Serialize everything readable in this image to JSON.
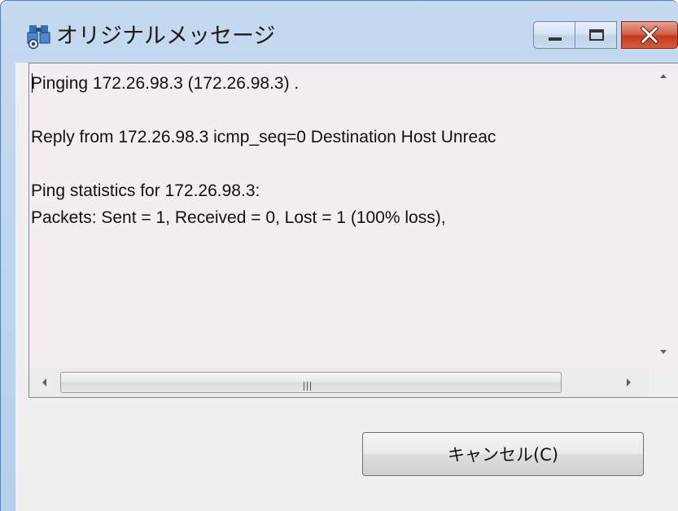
{
  "window": {
    "title": "オリジナルメッセージ",
    "icon": "binoculars-icon"
  },
  "title_bar_buttons": {
    "minimize": "minimize-icon",
    "maximize": "maximize-icon",
    "close": "close-icon"
  },
  "message": {
    "lines": [
      "Pinging 172.26.98.3 (172.26.98.3) .",
      "",
      "Reply from 172.26.98.3 icmp_seq=0 Destination Host Unreac",
      "",
      "Ping statistics for 172.26.98.3:",
      "Packets: Sent = 1, Received = 0, Lost = 1 (100% loss),"
    ]
  },
  "buttons": {
    "cancel_label": "キャンセル(C)"
  },
  "colors": {
    "titlebar": "#c5d9ef",
    "close_button": "#c9442a",
    "textbox_bg": "#f4eef4"
  }
}
